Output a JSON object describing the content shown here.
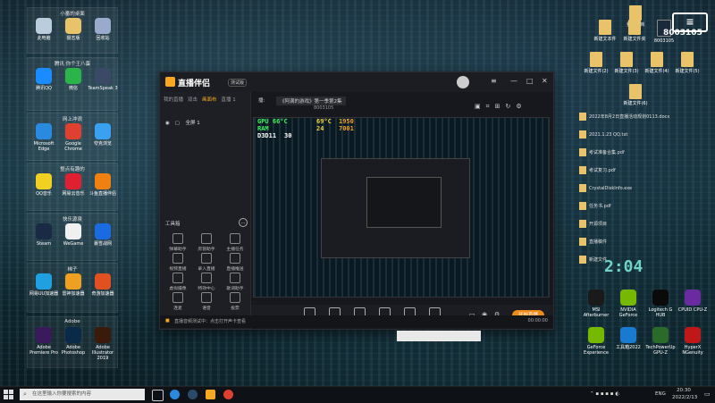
{
  "desktop": {
    "groups": [
      {
        "title": "小番的桌面",
        "items": [
          "此电脑",
          "摄志版",
          "回收站"
        ]
      },
      {
        "title": "腾讯 你个王八蛋",
        "items": [
          "腾讯QQ",
          "微信",
          "TeamSpeak 3"
        ]
      },
      {
        "title": "网上冲浪",
        "items": [
          "Microsoft Edge",
          "Google Chrome",
          "夸克浏览"
        ]
      },
      {
        "title": "整点有趣的",
        "items": [
          "QQ音乐",
          "网易云音乐",
          "斗鱼直播伴侣"
        ]
      },
      {
        "title": "快乐源泉",
        "items": [
          "Steam",
          "WeGame",
          "暴雪战网"
        ]
      },
      {
        "title": "梯子",
        "items": [
          "网易UU加速器",
          "雷神加速器",
          "奇游加速器"
        ]
      },
      {
        "title": "Adobe",
        "items": [
          "Adobe Premiere Pro",
          "Adobe Photoshop",
          "Adobe Illustrator 2019"
        ]
      }
    ],
    "right_top_labels": [
      "我的文档",
      "8003105",
      "新建文本件",
      "新建文件夹",
      "新建文件(2)",
      "新建文件(3)",
      "新建文件(4)",
      "新建文件(5)",
      "新建文件(6)"
    ],
    "docs": [
      "2022年8月2日直播活动规划0113.docx",
      "2021.1.23 QQ.txt",
      "考试准备合集.pdf",
      "考试复习.pdf",
      "CrystalDiskInfo.exe",
      "任务书.pdf",
      "开源项目",
      "直播稿件",
      "新建文件"
    ],
    "bottom_right_apps": [
      "MSI Afterburner",
      "NVIDIA GeForce",
      "Logitech G HUB",
      "CPUID CPU-Z",
      "GeForce Experience",
      "工具箱2022",
      "TechPowerUp GPU-Z",
      "HyperX NGenuity"
    ]
  },
  "app": {
    "name": "直播伴侣",
    "version_badge": "测试版",
    "left_tabs": [
      "我的直播",
      "双击",
      "画面布",
      "直播 1"
    ],
    "scene": "全屏 1",
    "tools_title": "工具箱",
    "tools": [
      "弹幕助手",
      "房管助手",
      "主播任务",
      "视频直播",
      "录入直播",
      "直播推送",
      "虚拟摄像",
      "特效中心",
      "歌词助手",
      "连麦",
      "语音",
      "投票"
    ],
    "info_title": "《阿满的游戏》第一季第2集",
    "stream_id": "8003105",
    "hud": {
      "gpu": "GPU",
      "gpu_val": "66°C",
      "ram": "RAM",
      "ram_val": "69°C",
      "fps": "1950",
      "ram2_val": "24",
      "fps2": "7001",
      "cpu": "D3D11",
      "cpu_val": "30"
    },
    "controls": [
      "摄像头",
      "摄像头",
      "手机投屏",
      "多窗口",
      "麦克风",
      "扬声器"
    ],
    "live_button": "开始直播",
    "status_text": "直播音频测试中：点击打开声卡查看",
    "status_time": "00:00:00"
  },
  "taskbar": {
    "search_placeholder": "在这里输入你要搜索的内容",
    "lang": "ENG",
    "time": "20:30",
    "date": "2022/2/13"
  },
  "colors": {
    "accent": "#f7a820",
    "live": "#f08a18"
  }
}
